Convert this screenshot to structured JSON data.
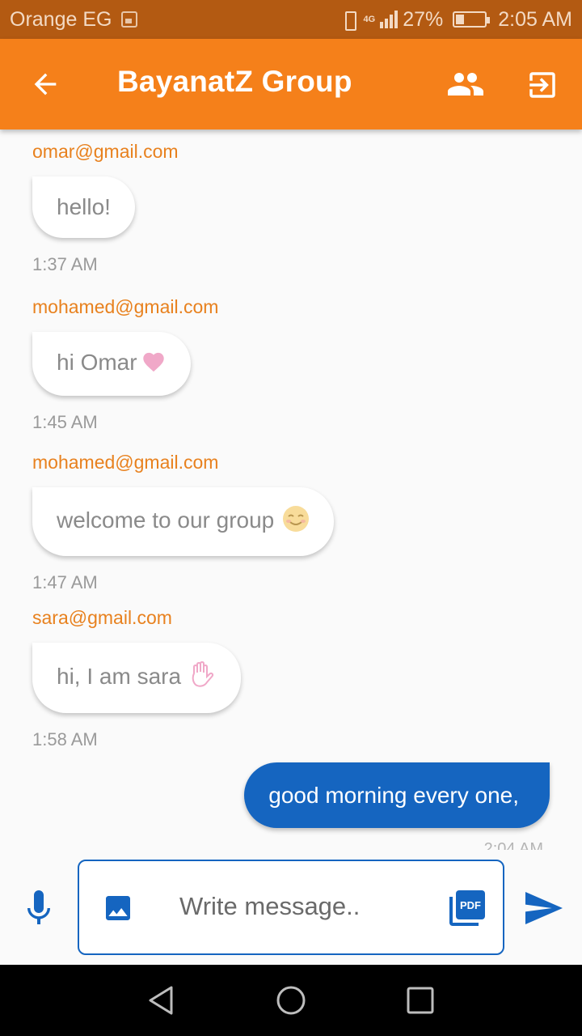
{
  "status_bar": {
    "carrier": "Orange EG",
    "network": "4G",
    "battery": "27%",
    "time": "2:05 AM"
  },
  "app_bar": {
    "title": "BayanatZ Group",
    "color": "#f5801a",
    "icons": [
      "arrow-back-icon",
      "group-icon",
      "exit-icon"
    ]
  },
  "messages": [
    {
      "sender": "omar@gmail.com",
      "text": "hello!",
      "time": "1:37 AM"
    },
    {
      "sender": "mohamed@gmail.com",
      "text": "hi Omar",
      "emoji": "heart-emoji",
      "time": "1:45 AM"
    },
    {
      "sender": "mohamed@gmail.com",
      "text": "welcome to our group",
      "emoji": "smiling-face-emoji",
      "time": "1:47 AM"
    },
    {
      "sender": "sara@gmail.com",
      "text": "hi, I am sara",
      "emoji": "waving-hand-emoji",
      "time": "1:58 AM"
    }
  ],
  "own_message": {
    "text": "good morning every one,",
    "time": "2:04 AM",
    "color": "#1565c0"
  },
  "composer": {
    "placeholder": "Write message..",
    "icons": [
      "microphone-icon",
      "image-icon",
      "pdf-icon",
      "send-icon"
    ],
    "accent": "#1565c0"
  },
  "nav_bar": {
    "icons": [
      "nav-back-icon",
      "nav-home-icon",
      "nav-recents-icon"
    ]
  }
}
